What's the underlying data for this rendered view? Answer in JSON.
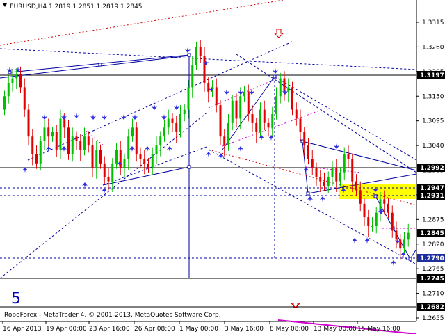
{
  "header": {
    "symbol_line": "EURUSD,H4  1.2819 1.2851 1.2819 1.2845",
    "footer": "RoboForex - MetaTrader 4, © 2001-2013, MetaQuotes Software Corp.",
    "big_label": "5"
  },
  "colors": {
    "bull": "#00c000",
    "bear": "#e00000",
    "grid": "#000000",
    "blue_line": "#0000a0",
    "red_dash": "#c00000",
    "magenta": "#d000d0",
    "zone": "#ffff00",
    "arrow": "#3030e0"
  },
  "chart_data": {
    "type": "candlestick",
    "y_ticks": [
      "1.3315",
      "1.3260",
      "1.3205",
      "1.3150",
      "1.3095",
      "1.3040",
      "1.2985",
      "1.2930",
      "1.2875",
      "1.2820",
      "1.2765",
      "1.2710",
      "1.2655"
    ],
    "x_ticks": [
      "16 Apr 2013",
      "19 Apr 00:00",
      "23 Apr 16:00",
      "26 Apr 08:00",
      "1 May 00:00",
      "3 May 16:00",
      "8 May 08:00",
      "13 May 00:00",
      "15 May 16:00"
    ],
    "ylim": [
      1.2655,
      1.334
    ],
    "price_labels": [
      {
        "text": "1.3197",
        "color": "#000000",
        "value": 1.3197
      },
      {
        "text": "1.2992",
        "color": "#000000",
        "value": 1.2992
      },
      {
        "text": "1.2947",
        "color": "#000000",
        "value": 1.2947
      },
      {
        "text": "1.2931",
        "color": "#000000",
        "value": 1.2931
      },
      {
        "text": "1.2845",
        "color": "#000000",
        "value": 1.2845
      },
      {
        "text": "1.2790",
        "color": "#1c2f9c",
        "value": 1.279
      },
      {
        "text": "1.2745",
        "color": "#000000",
        "value": 1.2745
      },
      {
        "text": "1.2682",
        "color": "#000000",
        "value": 1.2682
      }
    ],
    "closes": [
      1.315,
      1.318,
      1.319,
      1.32,
      1.317,
      1.312,
      1.306,
      1.302,
      1.3,
      1.305,
      1.308,
      1.306,
      1.307,
      1.303,
      1.31,
      1.308,
      1.302,
      1.306,
      1.305,
      1.303,
      1.306,
      1.304,
      1.299,
      1.303,
      1.3,
      1.297,
      1.296,
      1.3,
      1.303,
      1.299,
      1.301,
      1.306,
      1.308,
      1.302,
      1.301,
      1.3,
      1.299,
      1.302,
      1.304,
      1.306,
      1.308,
      1.31,
      1.309,
      1.307,
      1.311,
      1.312,
      1.317,
      1.322,
      1.326,
      1.324,
      1.318,
      1.316,
      1.317,
      1.313,
      1.306,
      1.304,
      1.309,
      1.314,
      1.31,
      1.315,
      1.316,
      1.311,
      1.309,
      1.307,
      1.312,
      1.309,
      1.308,
      1.311,
      1.315,
      1.319,
      1.316,
      1.317,
      1.312,
      1.31,
      1.307,
      1.304,
      1.301,
      1.299,
      1.297,
      1.296,
      1.295,
      1.297,
      1.299,
      1.296,
      1.298,
      1.302,
      1.301,
      1.296,
      1.294,
      1.291,
      1.288,
      1.286,
      1.286,
      1.289,
      1.292,
      1.291,
      1.289,
      1.285,
      1.283,
      1.281,
      1.283,
      1.2845
    ]
  }
}
